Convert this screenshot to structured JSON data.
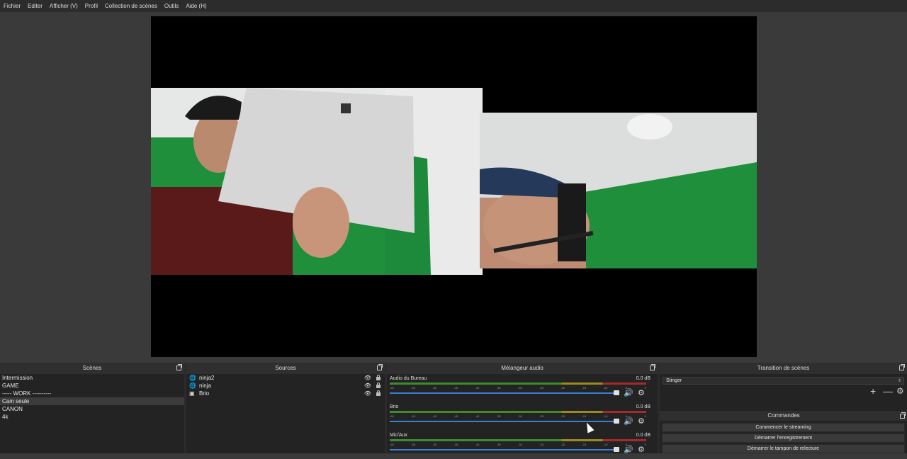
{
  "menu": [
    "Fichier",
    "Editer",
    "Afficher (V)",
    "Profil",
    "Collection de scènes",
    "Outils",
    "Aide (H)"
  ],
  "scenes": {
    "title": "Scènes",
    "items": [
      "Intermission",
      "GAME",
      "----- WORK ----------",
      "Cam seule",
      "CANON",
      "4k"
    ],
    "selected": "Cam seule"
  },
  "sources": {
    "title": "Sources",
    "items": [
      {
        "name": "ninja2",
        "icon": "globe-icon"
      },
      {
        "name": "ninja",
        "icon": "globe-icon"
      },
      {
        "name": "Brio",
        "icon": "camera-icon"
      }
    ]
  },
  "mixer": {
    "title": "Mélangeur audio",
    "ticks": [
      "-60",
      "-55",
      "-50",
      "-45",
      "-40",
      "-35",
      "-30",
      "-25",
      "-20",
      "-15",
      "-10",
      "-5",
      "0"
    ],
    "tracks": [
      {
        "name": "Audio du Bureau",
        "db": "0.0 dB"
      },
      {
        "name": "Brio",
        "db": "0.0 dB"
      },
      {
        "name": "Mic/Aux",
        "db": "0.0 dB"
      }
    ]
  },
  "transitions": {
    "title": "Transition de scènes",
    "selected": "Stinger"
  },
  "commands": {
    "title": "Commandes",
    "buttons": [
      "Commencer le streaming",
      "Démarrer l'enregistrement",
      "Démarrer le tampon de relecture"
    ]
  },
  "colors": {
    "background": "#3a3a3a",
    "fader": "#3a7fd5",
    "meter_green": "#3f8c2f",
    "meter_yellow": "#9a8a22",
    "meter_red": "#a52a2a"
  }
}
